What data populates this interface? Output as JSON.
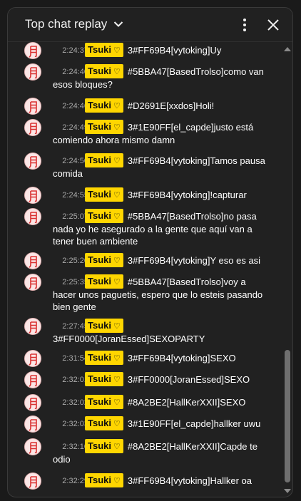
{
  "header": {
    "title": "Top chat replay"
  },
  "messages": [
    {
      "time": "2:24:37",
      "author": "Tsuki",
      "text": "3#FF69B4[vytoking]Uy"
    },
    {
      "time": "2:24:40",
      "author": "Tsuki",
      "text": "#5BBA47[BasedTrolso]como van esos bloques?"
    },
    {
      "time": "2:24:46",
      "author": "Tsuki",
      "text": "#D2691E[xxdos]Holi!"
    },
    {
      "time": "2:24:49",
      "author": "Tsuki",
      "text": "3#1E90FF[el_capde]justo está comiendo ahora mismo damn"
    },
    {
      "time": "2:24:50",
      "author": "Tsuki",
      "text": "3#FF69B4[vytoking]Tamos pausa comida"
    },
    {
      "time": "2:24:55",
      "author": "Tsuki",
      "text": "3#FF69B4[vytoking]!capturar"
    },
    {
      "time": "2:25:07",
      "author": "Tsuki",
      "text": "#5BBA47[BasedTrolso]no pasa nada yo he asegurado a la gente que aquí van a tener buen ambiente"
    },
    {
      "time": "2:25:20",
      "author": "Tsuki",
      "text": "3#FF69B4[vytoking]Y eso es asi"
    },
    {
      "time": "2:25:35",
      "author": "Tsuki",
      "text": "#5BBA47[BasedTrolso]voy a hacer unos paguetis, espero que lo esteis pasando bien gente"
    },
    {
      "time": "2:27:45",
      "author": "Tsuki",
      "text": "3#FF0000[JoranEssed]SEXOPARTY"
    },
    {
      "time": "2:31:54",
      "author": "Tsuki",
      "text": "3#FF69B4[vytoking]SEXO"
    },
    {
      "time": "2:32:01",
      "author": "Tsuki",
      "text": "3#FF0000[JoranEssed]SEXO"
    },
    {
      "time": "2:32:02",
      "author": "Tsuki",
      "text": "#8A2BE2[HallKerXXII]SEXO"
    },
    {
      "time": "2:32:03",
      "author": "Tsuki",
      "text": "3#1E90FF[el_capde]hallker uwu"
    },
    {
      "time": "2:32:10",
      "author": "Tsuki",
      "text": "#8A2BE2[HallKerXXII]Capde te odio"
    },
    {
      "time": "2:32:29",
      "author": "Tsuki",
      "text": "3#FF69B4[vytoking]Hallker oa"
    }
  ],
  "badge_heart": "♡",
  "colors": {
    "badge": "#ffd600",
    "background": "#212121",
    "avatar_bg": "#fbe6e6",
    "avatar_glyph": "#d93030"
  },
  "icons": {
    "title_dropdown": "chevron-down-icon",
    "more": "more-vert-icon",
    "close": "close-icon",
    "avatar": "moon-kanji-avatar-icon"
  }
}
